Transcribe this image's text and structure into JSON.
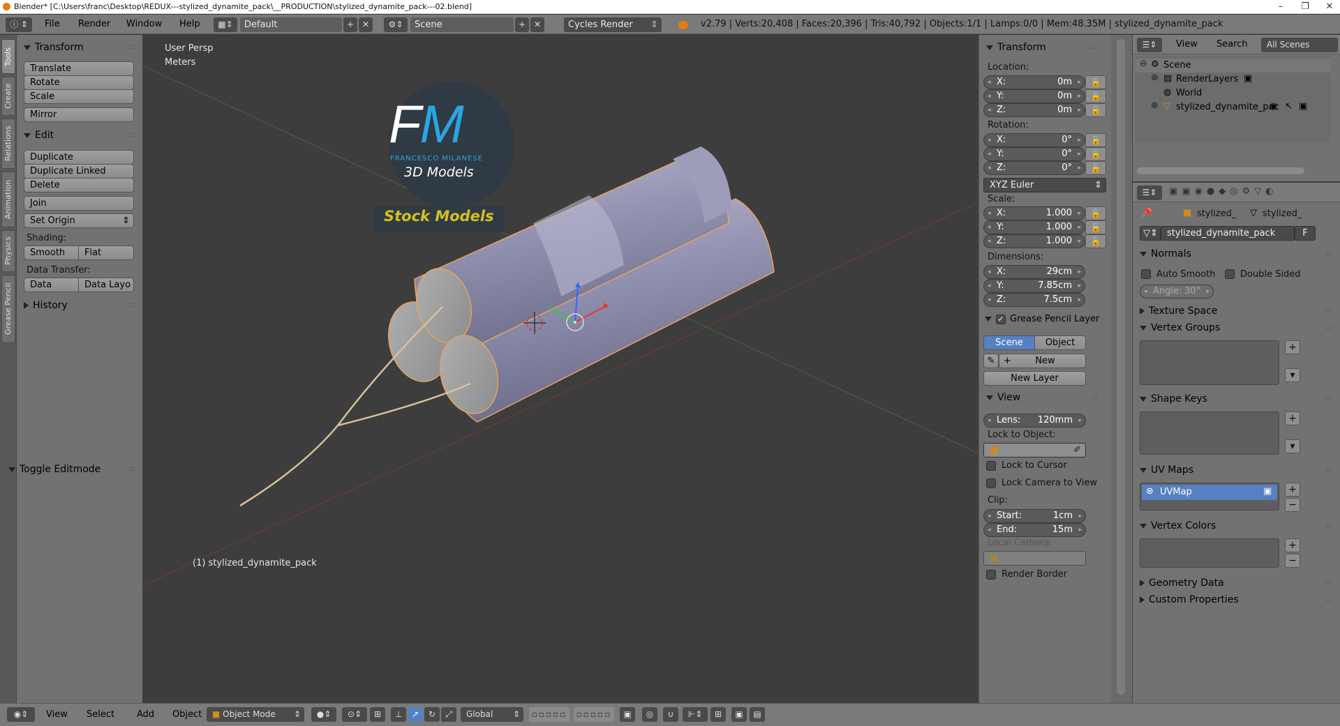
{
  "window": {
    "title": "Blender* [C:\\Users\\franc\\Desktop\\REDUX---stylized_dynamite_pack\\__PRODUCTION\\stylized_dynamite_pack---02.blend]",
    "minimize": "–",
    "maximize": "❐",
    "close": "✕"
  },
  "header": {
    "menus": [
      "File",
      "Render",
      "Window",
      "Help"
    ],
    "screen_layout": "Default",
    "scene": "Scene",
    "render_engine": "Cycles Render",
    "stats": "v2.79 | Verts:20,408 | Faces:20,396 | Tris:40,792 | Objects:1/1 | Lamps:0/0 | Mem:48.35M | stylized_dynamite_pack"
  },
  "tabs": [
    "Tools",
    "Create",
    "Relations",
    "Animation",
    "Physics",
    "Grease Pencil"
  ],
  "toolshelf": {
    "transform_title": "Transform",
    "translate": "Translate",
    "rotate": "Rotate",
    "scale": "Scale",
    "mirror": "Mirror",
    "edit_title": "Edit",
    "duplicate": "Duplicate",
    "duplicate_linked": "Duplicate Linked",
    "delete": "Delete",
    "join": "Join",
    "set_origin": "Set Origin",
    "shading_label": "Shading:",
    "smooth": "Smooth",
    "flat": "Flat",
    "data_transfer_label": "Data Transfer:",
    "data": "Data",
    "data_layout": "Data Layo",
    "history_title": "History",
    "toggle_editmode": "Toggle Editmode"
  },
  "viewport": {
    "view_name": "User Persp",
    "units": "Meters",
    "object_label": "(1) stylized_dynamite_pack",
    "watermark": {
      "initials": "FM",
      "name": "FRANCESCO MILANESE",
      "sub": "3D Models",
      "stock": "Stock Models"
    }
  },
  "npanel": {
    "transform_title": "Transform",
    "location_label": "Location:",
    "location": {
      "x": "0m",
      "y": "0m",
      "z": "0m"
    },
    "rotation_label": "Rotation:",
    "rotation": {
      "x": "0°",
      "y": "0°",
      "z": "0°"
    },
    "rotation_mode": "XYZ Euler",
    "scale_label": "Scale:",
    "scale": {
      "x": "1.000",
      "y": "1.000",
      "z": "1.000"
    },
    "dimensions_label": "Dimensions:",
    "dimensions": {
      "x": "29cm",
      "y": "7.85cm",
      "z": "7.5cm"
    },
    "axis": {
      "x": "X:",
      "y": "Y:",
      "z": "Z:"
    },
    "gp_title": "Grease Pencil Layer",
    "gp_scene": "Scene",
    "gp_object": "Object",
    "gp_new": "New",
    "gp_new_layer": "New Layer",
    "view_title": "View",
    "lens_key": "Lens:",
    "lens": "120mm",
    "lock_to_object": "Lock to Object:",
    "lock_to_cursor": "Lock to Cursor",
    "lock_camera": "Lock Camera to View",
    "clip_label": "Clip:",
    "clip_start_key": "Start:",
    "clip_start": "1cm",
    "clip_end_key": "End:",
    "clip_end": "15m",
    "local_camera": "Local Camera:",
    "render_border": "Render Border"
  },
  "outliner": {
    "view": "View",
    "search": "Search",
    "filter": "All Scenes",
    "items": [
      "Scene",
      "RenderLayers",
      "World",
      "stylized_dynamite_pac"
    ]
  },
  "properties": {
    "breadcrumb_obj": "stylized_",
    "breadcrumb_mesh": "stylized_",
    "mesh_name": "stylized_dynamite_pack",
    "fake_user": "F",
    "normals": "Normals",
    "auto_smooth": "Auto Smooth",
    "double_sided": "Double Sided",
    "angle_key": "Angle:",
    "angle": "30°",
    "texture_space": "Texture Space",
    "vertex_groups": "Vertex Groups",
    "shape_keys": "Shape Keys",
    "uv_maps": "UV Maps",
    "uvmap": "UVMap",
    "vertex_colors": "Vertex Colors",
    "geometry_data": "Geometry Data",
    "custom_properties": "Custom Properties"
  },
  "bottombar": {
    "menus": [
      "View",
      "Select",
      "Add",
      "Object"
    ],
    "mode": "Object Mode",
    "orientation": "Global"
  },
  "colors": {
    "accent_blue": "#5680c2",
    "viewport_bg": "#3d3d3d",
    "panel_bg": "#727272",
    "selection_outline": "#e8a35c",
    "stock_yellow": "#d4c21a"
  }
}
